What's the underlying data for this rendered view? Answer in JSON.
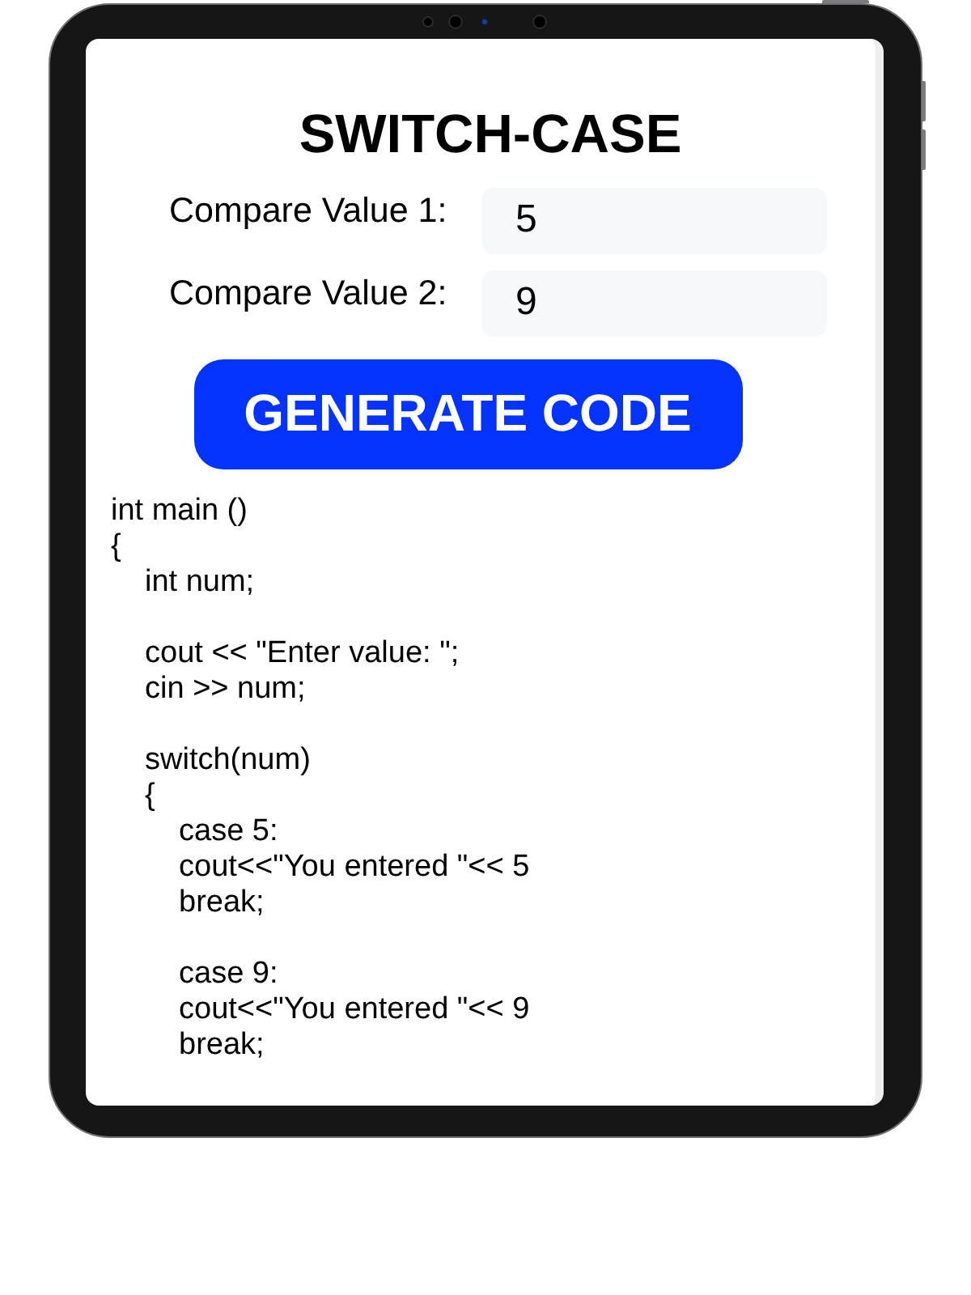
{
  "title": "SWITCH-CASE",
  "fields": [
    {
      "label": "Compare Value 1:",
      "value": "5"
    },
    {
      "label": "Compare Value 2:",
      "value": "9"
    }
  ],
  "button": {
    "label": "GENERATE CODE"
  },
  "code": [
    {
      "kind": "text",
      "text": "int main ()"
    },
    {
      "kind": "text",
      "text": "{",
      "children": [
        {
          "kind": "text",
          "text": "int num;"
        },
        {
          "kind": "blank"
        },
        {
          "kind": "text",
          "text": "cout << \"Enter value: \";"
        },
        {
          "kind": "text",
          "text": "cin >> num;"
        },
        {
          "kind": "blank"
        },
        {
          "kind": "text",
          "text": "switch(num)"
        },
        {
          "kind": "text",
          "text": "{",
          "children": [
            {
              "kind": "text",
              "text": "case 5:"
            },
            {
              "kind": "text",
              "text": "cout<<\"You entered \"<< 5"
            },
            {
              "kind": "text",
              "text": "break;"
            },
            {
              "kind": "blank"
            },
            {
              "kind": "text",
              "text": "case 9:"
            },
            {
              "kind": "text",
              "text": "cout<<\"You entered \"<< 9"
            },
            {
              "kind": "text",
              "text": "break;"
            }
          ]
        }
      ]
    }
  ]
}
